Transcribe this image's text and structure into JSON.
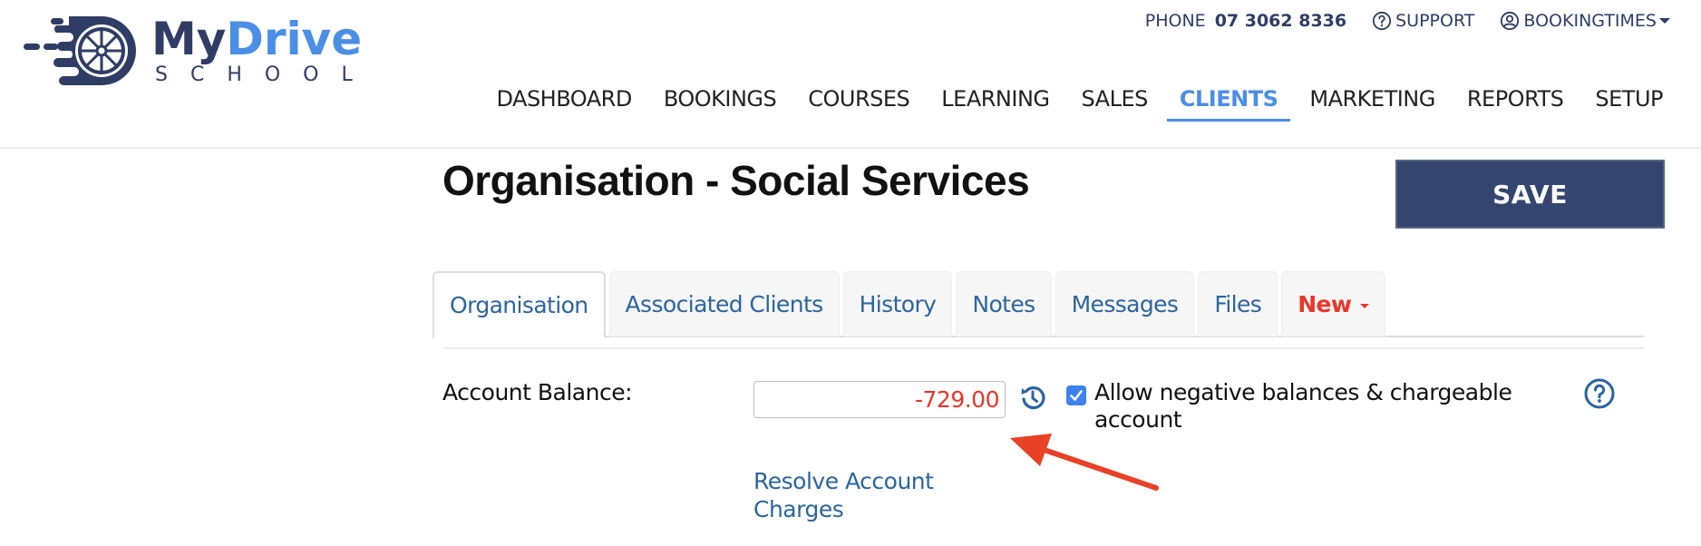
{
  "brand": {
    "name_part1": "My",
    "name_part2": "Drive",
    "tagline": "SCHOOL",
    "primary_color": "#2f3d66",
    "accent_color": "#4a8ee6"
  },
  "topbar": {
    "phone_label": "PHONE",
    "phone_number": "07 3062 8336",
    "support_label": "SUPPORT",
    "support_icon": "question-circle-icon",
    "account_label": "BOOKINGTIMES",
    "account_icon": "user-circle-icon"
  },
  "nav": {
    "items": [
      {
        "label": "DASHBOARD",
        "active": false
      },
      {
        "label": "BOOKINGS",
        "active": false
      },
      {
        "label": "COURSES",
        "active": false
      },
      {
        "label": "LEARNING",
        "active": false
      },
      {
        "label": "SALES",
        "active": false
      },
      {
        "label": "CLIENTS",
        "active": true
      },
      {
        "label": "MARKETING",
        "active": false
      },
      {
        "label": "REPORTS",
        "active": false
      },
      {
        "label": "SETUP",
        "active": false
      }
    ]
  },
  "page": {
    "title": "Organisation - Social Services",
    "save_label": "SAVE",
    "save_color": "#34466f"
  },
  "tabs": [
    {
      "label": "Organisation",
      "active": true
    },
    {
      "label": "Associated Clients",
      "active": false
    },
    {
      "label": "History",
      "active": false
    },
    {
      "label": "Notes",
      "active": false
    },
    {
      "label": "Messages",
      "active": false
    },
    {
      "label": "Files",
      "active": false
    },
    {
      "label": "New",
      "active": false,
      "dropdown": true,
      "color": "#e8372a"
    }
  ],
  "form": {
    "balance_label": "Account Balance:",
    "balance_value": "-729.00",
    "balance_color": "#e8372a",
    "history_icon": "history-icon",
    "allow_negative_checked": true,
    "allow_negative_label": "Allow negative balances & chargeable account",
    "help_icon": "help-circle-icon",
    "resolve_link": "Resolve Account Charges"
  },
  "annotation": {
    "type": "arrow",
    "color": "#e84126",
    "points_to": "balance-input"
  }
}
